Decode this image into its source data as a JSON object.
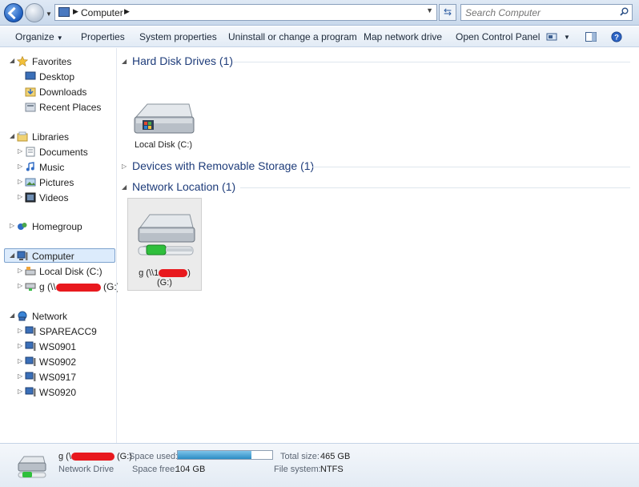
{
  "address": {
    "path_segment": "Computer",
    "search_placeholder": "Search Computer"
  },
  "toolbar": {
    "organize": "Organize",
    "properties": "Properties",
    "system_properties": "System properties",
    "uninstall": "Uninstall or change a program",
    "map_network_drive": "Map network drive",
    "open_control_panel": "Open Control Panel"
  },
  "sidebar": {
    "favorites": "Favorites",
    "desktop": "Desktop",
    "downloads": "Downloads",
    "recent_places": "Recent Places",
    "libraries": "Libraries",
    "documents": "Documents",
    "music": "Music",
    "pictures": "Pictures",
    "videos": "Videos",
    "homegroup": "Homegroup",
    "computer": "Computer",
    "local_disk": "Local Disk (C:)",
    "network_drive_prefix": "g (\\\\",
    "network_drive_suffix": "(G:)",
    "network": "Network",
    "network_items": [
      "SPAREACC9",
      "WS0901",
      "WS0902",
      "WS0917",
      "WS0920"
    ]
  },
  "content": {
    "hard_disk_group": "Hard Disk Drives (1)",
    "local_disk_label": "Local Disk (C:)",
    "removable_group": "Devices with Removable Storage (1)",
    "network_group": "Network Location (1)",
    "net_drive_label_prefix": "g (\\\\1",
    "net_drive_label_suffix": ")",
    "net_drive_label_line2": "(G:)"
  },
  "details": {
    "name_prefix": "g (\\",
    "name_suffix": "(G:)",
    "type": "Network Drive",
    "space_used_label": "Space used:",
    "space_free_label": "Space free:",
    "space_free_value": "104 GB",
    "total_size_label": "Total size:",
    "total_size_value": "465 GB",
    "file_system_label": "File system:",
    "file_system_value": "NTFS",
    "used_fraction": 0.78
  },
  "colors": {
    "group_title": "#1e3c7a",
    "selection": "#dcebfc",
    "redaction": "#e8191e"
  }
}
